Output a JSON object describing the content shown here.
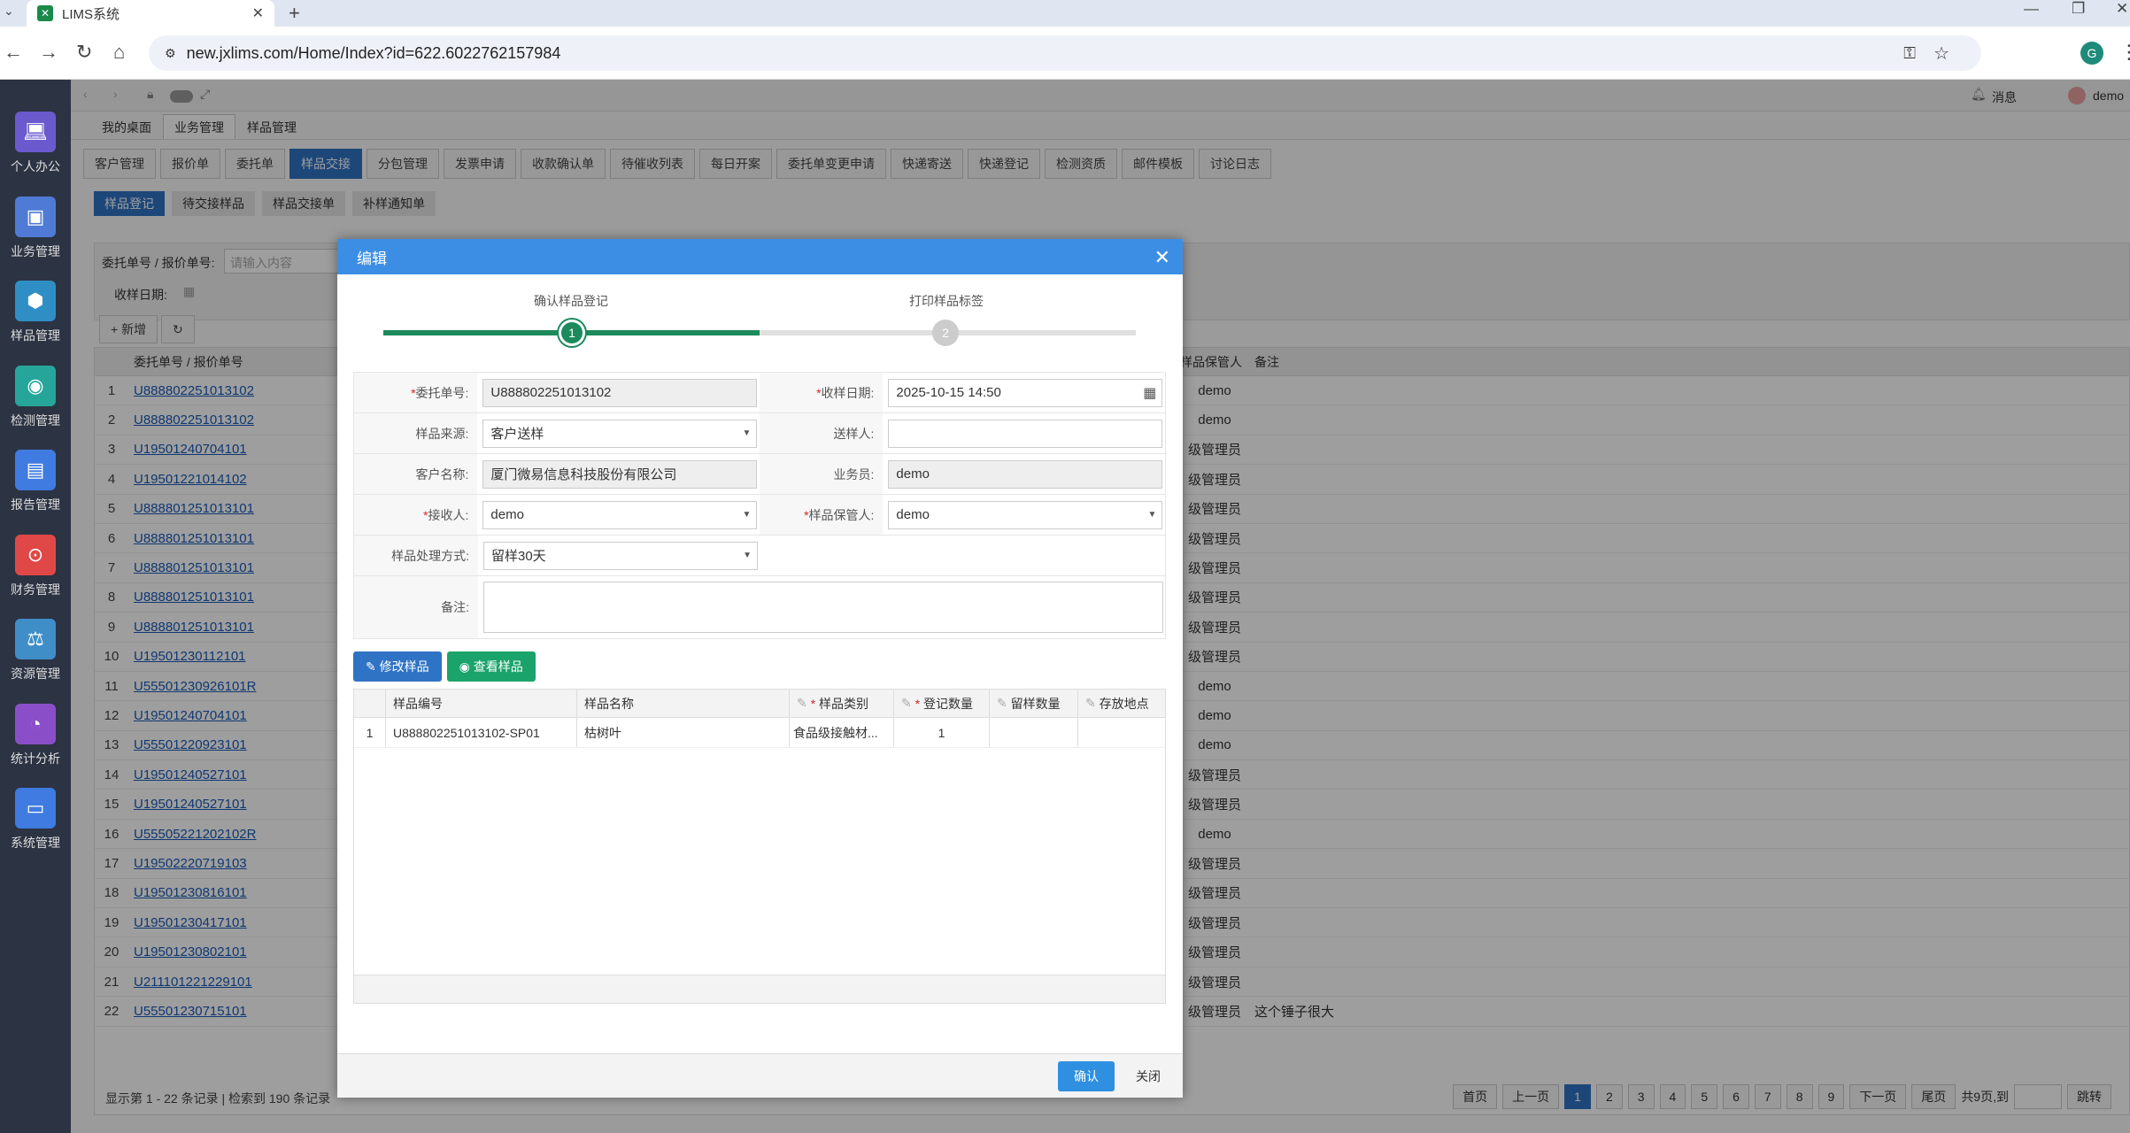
{
  "browser": {
    "tab_title": "LIMS系统",
    "url": "new.jxlims.com/Home/Index?id=622.6022762157984",
    "profile_initial": "G"
  },
  "sidebar": {
    "items": [
      {
        "label": "个人办公",
        "icon": "laptop-icon",
        "color": "#6a5acd"
      },
      {
        "label": "业务管理",
        "icon": "briefcase-icon",
        "color": "#4f7bd6"
      },
      {
        "label": "样品管理",
        "icon": "cubes-icon",
        "color": "#2f8fc4"
      },
      {
        "label": "检测管理",
        "icon": "map-pin-icon",
        "color": "#26a69a"
      },
      {
        "label": "报告管理",
        "icon": "document-icon",
        "color": "#3f7be0"
      },
      {
        "label": "财务管理",
        "icon": "money-icon",
        "color": "#e04848"
      },
      {
        "label": "资源管理",
        "icon": "scale-icon",
        "color": "#3f8ec8"
      },
      {
        "label": "统计分析",
        "icon": "pie-chart-icon",
        "color": "#8a4fc8"
      },
      {
        "label": "系统管理",
        "icon": "monitor-icon",
        "color": "#3f7be0"
      }
    ]
  },
  "topbar": {
    "messages": "消息",
    "user": "demo"
  },
  "page_tabs": [
    "我的桌面",
    "业务管理",
    "样品管理"
  ],
  "toolbar": [
    "客户管理",
    "报价单",
    "委托单",
    "样品交接",
    "分包管理",
    "发票申请",
    "收款确认单",
    "待催收列表",
    "每日开案",
    "委托单变更申请",
    "快递寄送",
    "快递登记",
    "检测资质",
    "邮件模板",
    "讨论日志"
  ],
  "subtabs": [
    "样品登记",
    "待交接样品",
    "样品交接单",
    "补样通知单"
  ],
  "search": {
    "order_label": "委托单号 / 报价单号:",
    "order_placeholder": "请输入内容",
    "date_label": "收样日期:",
    "add_label": "新增"
  },
  "grid": {
    "header_id": "委托单号 / 报价单号",
    "header_keeper": "样品保管人",
    "header_remark": "备注",
    "rows": [
      {
        "n": "1",
        "id": "U888802251013102",
        "keeper": "demo",
        "remark": ""
      },
      {
        "n": "2",
        "id": "U888802251013102",
        "keeper": "demo",
        "remark": ""
      },
      {
        "n": "3",
        "id": "U19501240704101",
        "keeper": "级管理员",
        "remark": ""
      },
      {
        "n": "4",
        "id": "U19501221014102",
        "keeper": "级管理员",
        "remark": ""
      },
      {
        "n": "5",
        "id": "U888801251013101",
        "keeper": "级管理员",
        "remark": ""
      },
      {
        "n": "6",
        "id": "U888801251013101",
        "keeper": "级管理员",
        "remark": ""
      },
      {
        "n": "7",
        "id": "U888801251013101",
        "keeper": "级管理员",
        "remark": ""
      },
      {
        "n": "8",
        "id": "U888801251013101",
        "keeper": "级管理员",
        "remark": ""
      },
      {
        "n": "9",
        "id": "U888801251013101",
        "keeper": "级管理员",
        "remark": ""
      },
      {
        "n": "10",
        "id": "U19501230112101",
        "keeper": "级管理员",
        "remark": ""
      },
      {
        "n": "11",
        "id": "U55501230926101R",
        "keeper": "demo",
        "remark": ""
      },
      {
        "n": "12",
        "id": "U19501240704101",
        "keeper": "demo",
        "remark": ""
      },
      {
        "n": "13",
        "id": "U55501220923101",
        "keeper": "demo",
        "remark": ""
      },
      {
        "n": "14",
        "id": "U19501240527101",
        "keeper": "级管理员",
        "remark": ""
      },
      {
        "n": "15",
        "id": "U19501240527101",
        "keeper": "级管理员",
        "remark": ""
      },
      {
        "n": "16",
        "id": "U55505221202102R",
        "keeper": "demo",
        "remark": ""
      },
      {
        "n": "17",
        "id": "U19502220719103",
        "keeper": "级管理员",
        "remark": ""
      },
      {
        "n": "18",
        "id": "U19501230816101",
        "keeper": "级管理员",
        "remark": ""
      },
      {
        "n": "19",
        "id": "U19501230417101",
        "keeper": "级管理员",
        "remark": ""
      },
      {
        "n": "20",
        "id": "U19501230802101",
        "keeper": "级管理员",
        "remark": ""
      },
      {
        "n": "21",
        "id": "U211101221229101",
        "keeper": "级管理员",
        "remark": ""
      },
      {
        "n": "22",
        "id": "U55501230715101",
        "keeper": "级管理员",
        "remark": "这个锤子很大"
      }
    ],
    "footer": "显示第 1 - 22 条记录 | 检索到 190 条记录"
  },
  "pager": {
    "first": "首页",
    "prev": "上一页",
    "pages": [
      "1",
      "2",
      "3",
      "4",
      "5",
      "6",
      "7",
      "8",
      "9"
    ],
    "next": "下一页",
    "last": "尾页",
    "total": "共9页,到",
    "jump": "跳转"
  },
  "modal": {
    "title": "编辑",
    "step1": "确认样品登记",
    "step2": "打印样品标签",
    "step1_num": "1",
    "step2_num": "2",
    "fields": {
      "order_no_label": "委托单号:",
      "order_no": "U888802251013102",
      "recv_date_label": "收样日期:",
      "recv_date": "2025-10-15 14:50",
      "source_label": "样品来源:",
      "source": "客户送样",
      "sender_label": "送样人:",
      "sender": "",
      "customer_label": "客户名称:",
      "customer": "厦门微易信息科技股份有限公司",
      "salesman_label": "业务员:",
      "salesman": "demo",
      "receiver_label": "接收人:",
      "receiver": "demo",
      "keeper_label": "样品保管人:",
      "keeper": "demo",
      "handling_label": "样品处理方式:",
      "handling": "留样30天",
      "remark_label": "备注:",
      "remark": ""
    },
    "edit_sample": "修改样品",
    "view_sample": "查看样品",
    "sample_grid": {
      "headers": [
        "样品编号",
        "样品名称",
        "样品类别",
        "登记数量",
        "留样数量",
        "存放地点"
      ],
      "rows": [
        {
          "n": "1",
          "code": "U888802251013102-SP01",
          "name": "枯树叶",
          "type": "食品级接触材...",
          "reg_qty": "1",
          "keep_qty": "",
          "location": ""
        }
      ]
    },
    "confirm": "确认",
    "close": "关闭"
  },
  "colors": {
    "primary": "#2f73c4",
    "header": "#3c8ee5",
    "step_green": "#1c8a5c",
    "view_button": "#1aa36a"
  }
}
